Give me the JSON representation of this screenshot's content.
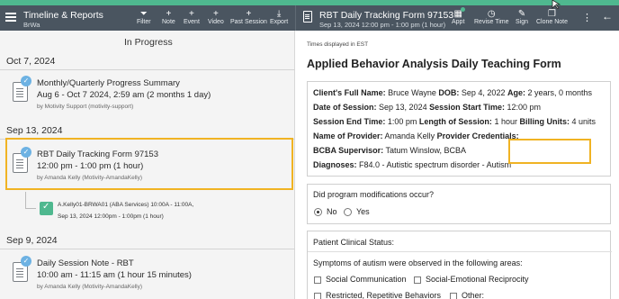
{
  "colors": {
    "header_bg": "#4a5560",
    "accent_green": "#4fb88f",
    "highlight": "#f0b323",
    "check_blue": "#6db2e3"
  },
  "timeline": {
    "title": "Timeline & Reports",
    "subtitle": "BrWa",
    "tools": [
      {
        "label": "Filter",
        "icon": "filter-icon"
      },
      {
        "label": "Note",
        "icon": "plus-icon"
      },
      {
        "label": "Event",
        "icon": "plus-icon"
      },
      {
        "label": "Video",
        "icon": "plus-icon"
      },
      {
        "label": "Past Session",
        "icon": "plus-icon"
      },
      {
        "label": "Export",
        "icon": "download-icon"
      }
    ]
  },
  "form_header": {
    "title": "RBT Daily Tracking Form 97153",
    "subtitle": "Sep 13, 2024 12:00 pm - 1:00 pm (1 hour)",
    "tools": [
      {
        "label": "Appt",
        "icon": "calendar-icon"
      },
      {
        "label": "Revise Time",
        "icon": "clock-icon"
      },
      {
        "label": "Sign",
        "icon": "pen-icon"
      },
      {
        "label": "Clone Note",
        "icon": "copy-icon"
      }
    ]
  },
  "left": {
    "heading": "In Progress",
    "groups": [
      {
        "date": "Oct 7, 2024",
        "title": "Monthly/Quarterly Progress Summary",
        "time": "Aug 6 - Oct 7 2024, 2:59 am (2 months 1 day)",
        "by": "by Motivity Support (motivity-support)"
      },
      {
        "date": "Sep 13, 2024",
        "title": "RBT Daily Tracking Form 97153",
        "time": "12:00 pm - 1:00 pm (1 hour)",
        "by": "by Amanda Kelly (Motivity-AmandaKelly)"
      },
      {
        "date": "Sep 9, 2024",
        "title": "Daily Session Note - RBT",
        "time": "10:00 am - 11:15 am (1 hour 15 minutes)",
        "by": "by Amanda Kelly (Motivity-AmandaKelly)"
      }
    ],
    "sub_item": {
      "line1": "A.Kelly01-BRWA01 (ABA Services) 10:00A - 11:00A,",
      "line2": "Sep 13, 2024 12:00pm - 1:00pm (1 hour)"
    }
  },
  "right": {
    "timezone": "Times displayed in EST",
    "form_title": "Applied Behavior Analysis Daily Teaching Form",
    "info": {
      "client_label": "Client's Full Name:",
      "client": "Bruce Wayne",
      "dob_label": "DOB:",
      "dob": "Sep 4, 2022",
      "age_label": "Age:",
      "age": "2 years, 0 months",
      "date_label": "Date of Session:",
      "date": "Sep 13, 2024",
      "start_label": "Session Start Time:",
      "start": "12:00 pm",
      "end_label": "Session End Time:",
      "end": "1:00 pm",
      "length_label": "Length of Session:",
      "length": "1 hour",
      "billing_label": "Billing Units:",
      "billing": "4 units",
      "provider_label": "Name of Provider:",
      "provider": "Amanda Kelly",
      "cred_label": "Provider Credentials:",
      "cred": "",
      "bcba_label": "BCBA Supervisor:",
      "bcba": "Tatum Winslow, BCBA",
      "dx_label": "Diagnoses:",
      "dx": "F84.0 - Autistic spectrum disorder - Autism"
    },
    "question": {
      "label": "Did program modifications occur?",
      "options": [
        "No",
        "Yes"
      ],
      "selected": "No"
    },
    "clinical": {
      "title": "Patient Clinical Status:",
      "prompt": "Symptoms of autism were observed in the following areas:",
      "options": [
        "Social Communication",
        "Social-Emotional Reciprocity",
        "Restricted, Repetitive Behaviors",
        "Other:"
      ]
    }
  }
}
